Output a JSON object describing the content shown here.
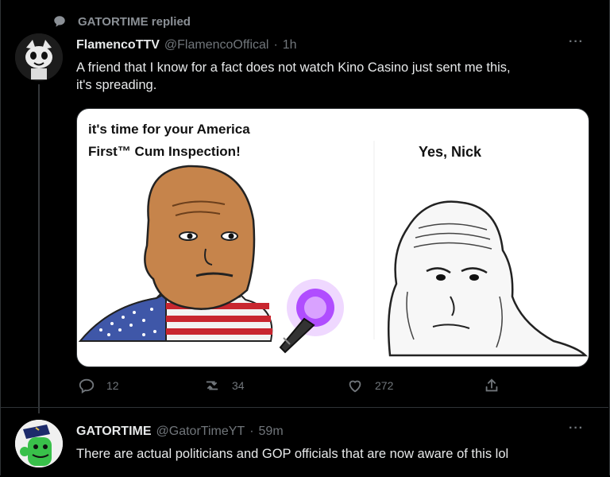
{
  "replied": {
    "text": "GATORTIME replied",
    "icon": "speech-bubble-icon"
  },
  "tweet1": {
    "name": "FlamencoTTV",
    "handle": "@FlamencoOffical",
    "separator": "·",
    "time": "1h",
    "more": "···",
    "text_line1": "A friend that I know for a fact does not watch Kino Casino just sent me this,",
    "text_line2": "it's spreading.",
    "media": {
      "left_caption_line1": "it's time for your America",
      "left_caption_line2": "First™ Cum Inspection!",
      "right_caption": "Yes, Nick"
    },
    "actions": {
      "reply_count": "12",
      "retweet_count": "34",
      "like_count": "272"
    }
  },
  "tweet2": {
    "name": "GATORTIME",
    "handle": "@GatorTimeYT",
    "separator": "·",
    "time": "59m",
    "more": "···",
    "text": "There are actual politicians and GOP officials that are now aware of this lol"
  },
  "colors": {
    "background": "#000000",
    "text_primary": "#e7e9ea",
    "text_secondary": "#71767b",
    "border": "#2f3336",
    "avatar2_green": "#39c04a",
    "flashlight_glow": "#b04dff"
  }
}
